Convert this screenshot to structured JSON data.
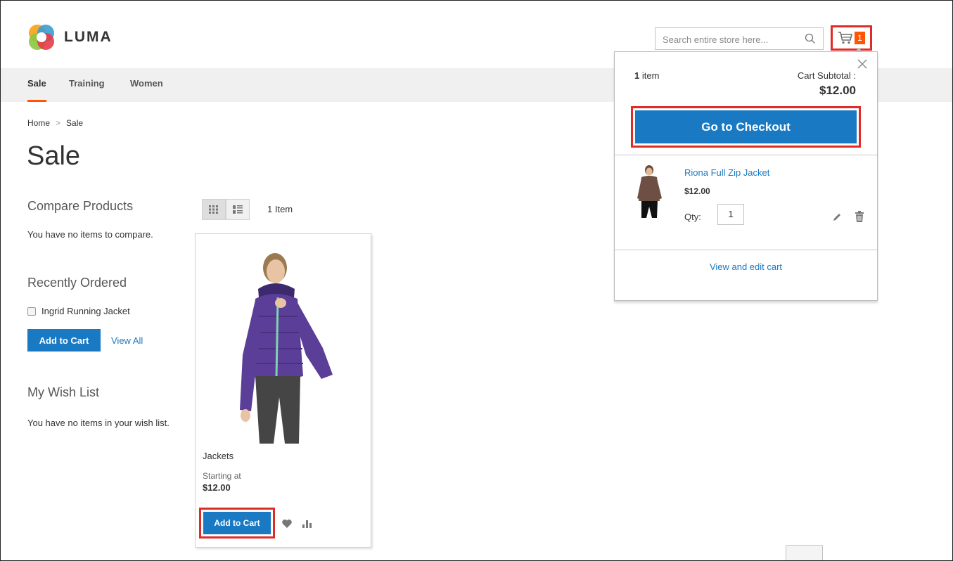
{
  "header": {
    "logo_text": "LUMA",
    "search_placeholder": "Search entire store here...",
    "cart_count": "1"
  },
  "nav": {
    "items": [
      "Sale",
      "Training",
      "Women"
    ],
    "active": "Sale"
  },
  "breadcrumb": {
    "home": "Home",
    "separator": ">",
    "current": "Sale"
  },
  "page_title": "Sale",
  "sidebar": {
    "compare_title": "Compare Products",
    "compare_empty": "You have no items to compare.",
    "recent_title": "Recently Ordered",
    "recent_item": "Ingrid Running Jacket",
    "add_to_cart": "Add to Cart",
    "view_all": "View All",
    "wishlist_title": "My Wish List",
    "wishlist_empty": "You have no items in your wish list."
  },
  "toolbar": {
    "item_count": "1 Item"
  },
  "product": {
    "name": "Jackets",
    "price_label": "Starting at",
    "price": "$12.00",
    "add_to_cart": "Add to Cart"
  },
  "minicart": {
    "count_num": "1",
    "count_word": "item",
    "subtotal_label": "Cart Subtotal :",
    "subtotal": "$12.00",
    "checkout": "Go to Checkout",
    "item_name": "Riona Full Zip Jacket",
    "item_price": "$12.00",
    "qty_label": "Qty:",
    "qty_value": "1",
    "view_edit": "View and edit cart"
  },
  "colors": {
    "accent_orange": "#ff5501",
    "primary_blue": "#1979c3",
    "highlight_red": "#e02b27",
    "jacket_purple": "#5b3e97"
  },
  "icons": [
    "luma-logo-icon",
    "search-icon",
    "cart-icon",
    "close-icon",
    "grid-icon",
    "list-icon",
    "heart-icon",
    "compare-icon",
    "edit-icon",
    "trash-icon"
  ]
}
